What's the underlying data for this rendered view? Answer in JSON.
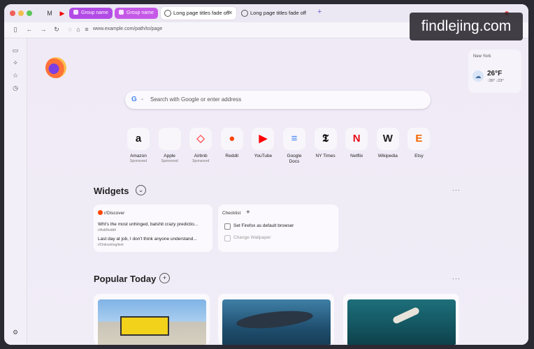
{
  "tabs": {
    "group1": "Group name",
    "group2": "Group name",
    "tab1": "Long page titles fade off",
    "tab2": "Long page titles fade off"
  },
  "toolbar": {
    "url": "www.example.com/path/to/page"
  },
  "watermark": "findlejing.com",
  "weather": {
    "city": "New York",
    "temp": "26°F",
    "range": "↑30° ↓23°"
  },
  "search": {
    "placeholder": "Search with Google or enter address",
    "engine_letter": "G"
  },
  "sites": [
    {
      "name": "Amazon",
      "sponsored": "Sponsored",
      "glyph": "a",
      "color": "#111111"
    },
    {
      "name": "Apple",
      "sponsored": "Sponsored",
      "glyph": "",
      "color": "#111111"
    },
    {
      "name": "Airbnb",
      "sponsored": "Sponsored",
      "glyph": "◇",
      "color": "#ff5a5f"
    },
    {
      "name": "Reddit",
      "sponsored": "",
      "glyph": "●",
      "color": "#ff4500"
    },
    {
      "name": "YouTube",
      "sponsored": "",
      "glyph": "▶",
      "color": "#ff0000"
    },
    {
      "name": "Google\nDocs",
      "sponsored": "",
      "glyph": "≡",
      "color": "#4285f4"
    },
    {
      "name": "NY Times",
      "sponsored": "",
      "glyph": "𝕿",
      "color": "#111111"
    },
    {
      "name": "Netflix",
      "sponsored": "",
      "glyph": "N",
      "color": "#e50914"
    },
    {
      "name": "Wikipedia",
      "sponsored": "",
      "glyph": "W",
      "color": "#222222"
    },
    {
      "name": "Etsy",
      "sponsored": "",
      "glyph": "E",
      "color": "#f56400"
    }
  ],
  "widgets": {
    "title": "Widgets",
    "more": "···",
    "discover": {
      "title": "r/Discover",
      "items": [
        {
          "text": "Wht's the most unhinged, batshit crazy predictio...",
          "source": "r/AskReddit"
        },
        {
          "text": "Last day at job, I don't think anyone understand...",
          "source": "r/Ontrucking/text"
        }
      ]
    },
    "checklist": {
      "title": "Checklist",
      "add": "+",
      "items": [
        "Set Firefox as default browser",
        "Change Wallpaper"
      ]
    }
  },
  "popular": {
    "title": "Popular Today",
    "add": "+",
    "more": "···"
  }
}
